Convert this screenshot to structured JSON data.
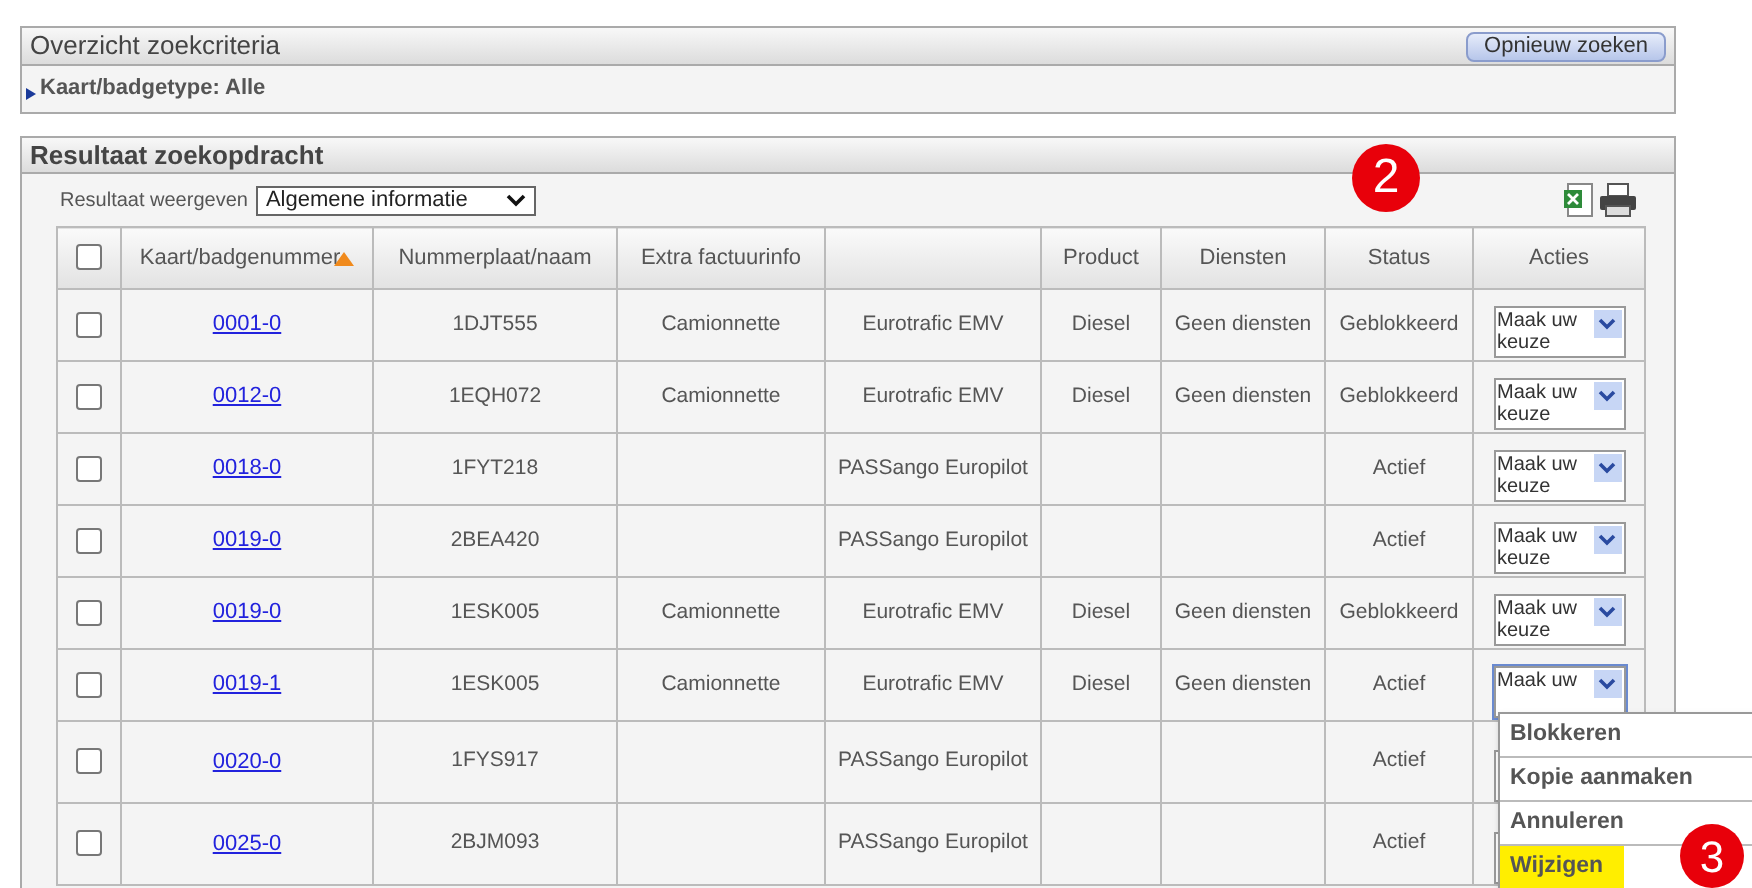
{
  "criteria_panel": {
    "title": "Overzicht zoekcriteria",
    "button": "Opnieuw zoeken",
    "expander": {
      "label": "Kaart/badgetype: Alle",
      "expanded": false
    }
  },
  "results_panel": {
    "title": "Resultaat zoekopdracht",
    "view_label": "Resultaat weergeven",
    "view_value": "Algemene informatie"
  },
  "table": {
    "select_all": {
      "checked": false
    },
    "columns": [
      {
        "kind": "check"
      },
      {
        "label": "Kaart/badgenummer",
        "sorted": true
      },
      {
        "label": "Nummerplaat/naam",
        "sorted": false
      },
      {
        "label": "Extra factuurinfo",
        "sorted": false
      },
      {
        "kind": "blank"
      },
      {
        "label": "Product",
        "sorted": false
      },
      {
        "label": "Diensten",
        "sorted": false
      },
      {
        "label": "Status",
        "sorted": false
      },
      {
        "label": "Acties",
        "sorted": false
      }
    ],
    "rows": [
      {
        "checked": false,
        "card": "0001-0",
        "plate": "1DJT555",
        "extra": "Camionnette",
        "type": "Eurotrafic EMV",
        "product": "Diesel",
        "services": "Geen diensten",
        "status": "Geblokkeerd",
        "action": "Maak uw keuze",
        "menu_open": false
      },
      {
        "checked": false,
        "card": "0012-0",
        "plate": "1EQH072",
        "extra": "Camionnette",
        "type": "Eurotrafic EMV",
        "product": "Diesel",
        "services": "Geen diensten",
        "status": "Geblokkeerd",
        "action": "Maak uw keuze",
        "menu_open": false
      },
      {
        "checked": false,
        "card": "0018-0",
        "plate": "1FYT218",
        "type": "PASSango Europilot",
        "status": "Actief",
        "action": "Maak uw keuze",
        "menu_open": false
      },
      {
        "checked": false,
        "card": "0019-0",
        "plate": "2BEA420",
        "type": "PASSango Europilot",
        "status": "Actief",
        "action": "Maak uw keuze",
        "menu_open": false
      },
      {
        "checked": false,
        "card": "0019-0",
        "plate": "1ESK005",
        "extra": "Camionnette",
        "type": "Eurotrafic EMV",
        "product": "Diesel",
        "services": "Geen diensten",
        "status": "Geblokkeerd",
        "action": "Maak uw keuze",
        "menu_open": false
      },
      {
        "checked": false,
        "card": "0019-1",
        "plate": "1ESK005",
        "extra": "Camionnette",
        "type": "Eurotrafic EMV",
        "product": "Diesel",
        "services": "Geen diensten",
        "status": "Actief",
        "action": "Maak uw",
        "menu_open": true
      },
      {
        "checked": false,
        "card": "0020-0",
        "plate": "1FYS917",
        "type": "PASSango Europilot",
        "status": "Actief",
        "menu_open": false
      },
      {
        "checked": false,
        "card": "0025-0",
        "plate": "2BJM093",
        "type": "PASSango Europilot",
        "status": "Actief",
        "menu_open": false
      }
    ]
  },
  "action_menu": {
    "items": [
      {
        "label": "Blokkeren",
        "selected": false
      },
      {
        "label": "Kopie aanmaken",
        "selected": false
      },
      {
        "label": "Annuleren",
        "selected": false
      },
      {
        "label": "Wijzigen",
        "selected": true
      }
    ]
  },
  "annotations": [
    {
      "label": "2"
    },
    {
      "label": "3"
    }
  ]
}
